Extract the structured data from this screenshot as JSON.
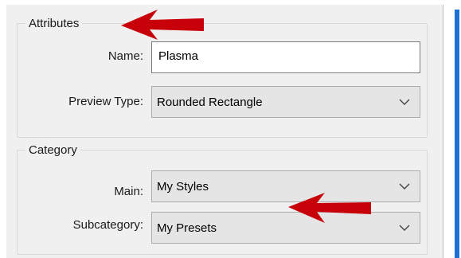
{
  "attributes": {
    "legend": "Attributes",
    "name_label": "Name:",
    "name_value": "Plasma",
    "preview_label": "Preview Type:",
    "preview_value": "Rounded Rectangle"
  },
  "category": {
    "legend": "Category",
    "main_label": "Main:",
    "main_value": "My Styles",
    "sub_label": "Subcategory:",
    "sub_value": "My Presets"
  },
  "annotations": {
    "arrow_color": "#c8000a"
  },
  "colors": {
    "panel_bg": "#f0f0f0",
    "accent_strip": "#1a6fd8"
  }
}
